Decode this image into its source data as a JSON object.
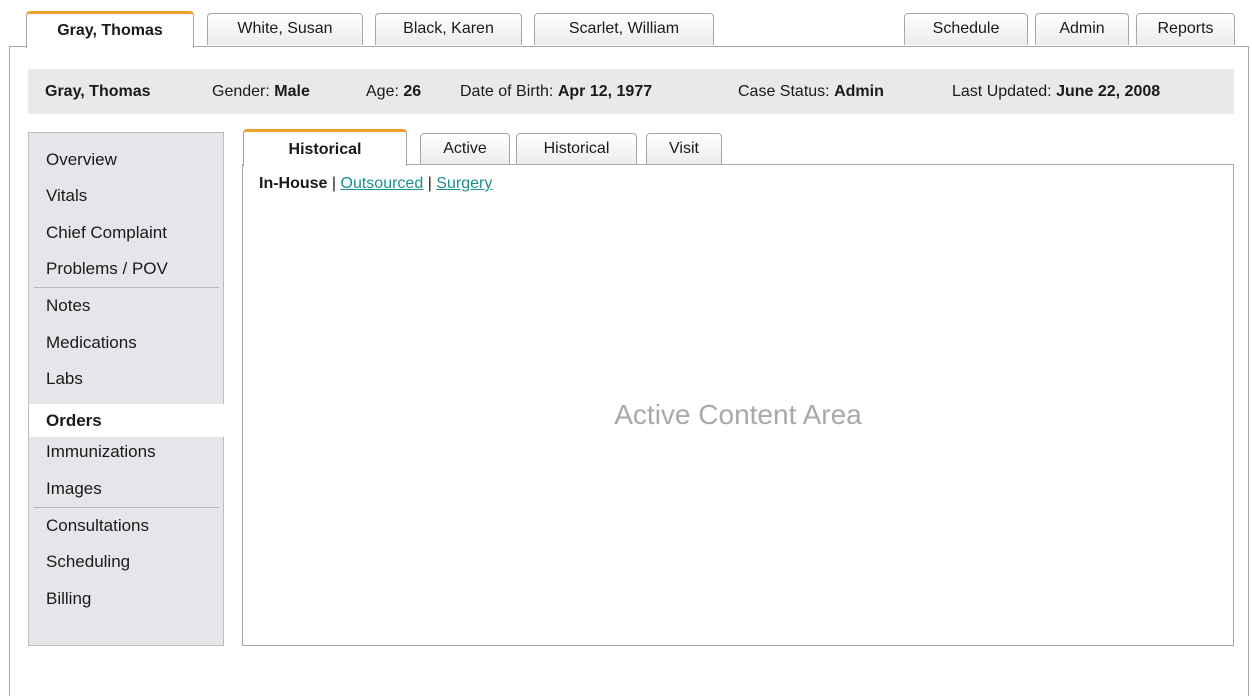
{
  "patient_tabs": [
    {
      "label": "Gray, Thomas",
      "active": true
    },
    {
      "label": "White, Susan",
      "active": false
    },
    {
      "label": "Black, Karen",
      "active": false
    },
    {
      "label": "Scarlet, William",
      "active": false
    }
  ],
  "app_tabs": [
    {
      "label": "Schedule"
    },
    {
      "label": "Admin"
    },
    {
      "label": "Reports"
    }
  ],
  "patient_bar": {
    "name": "Gray, Thomas",
    "gender_label": "Gender:",
    "gender_value": "Male",
    "age_label": "Age:",
    "age_value": "26",
    "dob_label": "Date of Birth:",
    "dob_value": "Apr 12, 1977",
    "case_status_label": "Case Status:",
    "case_status_value": "Admin",
    "last_updated_label": "Last Updated:",
    "last_updated_value": "June 22, 2008"
  },
  "sidebar": {
    "items": [
      {
        "label": "Overview"
      },
      {
        "label": "Vitals"
      },
      {
        "label": "Chief Complaint"
      },
      {
        "label": "Problems / POV"
      },
      {
        "label": "Notes"
      },
      {
        "label": "Medications"
      },
      {
        "label": "Labs"
      },
      {
        "label": "Orders",
        "active": true
      },
      {
        "label": "Immunizations"
      },
      {
        "label": "Images"
      },
      {
        "label": "Consultations"
      },
      {
        "label": "Scheduling"
      },
      {
        "label": "Billing"
      }
    ]
  },
  "content_tabs": [
    {
      "label": "Historical",
      "active": true
    },
    {
      "label": "Active"
    },
    {
      "label": "Historical"
    },
    {
      "label": "Visit"
    }
  ],
  "sublinks": {
    "current": "In-House",
    "separator": "|",
    "links": [
      "Outsourced",
      "Surgery"
    ]
  },
  "content": {
    "placeholder": "Active Content Area"
  },
  "colors": {
    "accent": "#f0a030",
    "link": "#1a8f8f",
    "sidebar_bg": "#e6e6ea",
    "patient_bar_bg": "#e9e9ec"
  }
}
